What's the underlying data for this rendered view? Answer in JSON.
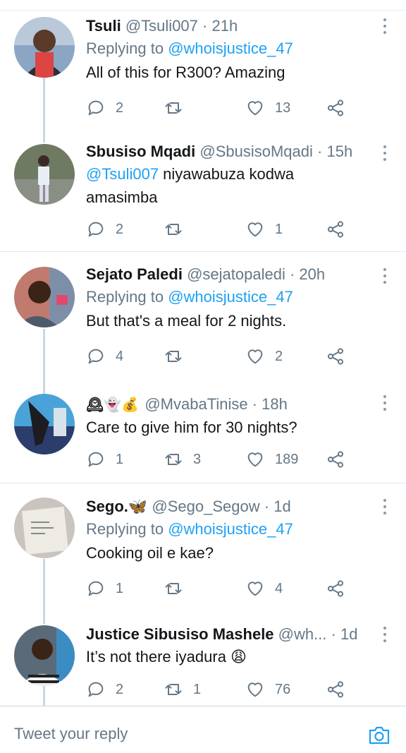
{
  "tweets": [
    {
      "name": "Tsuli",
      "handle": "@Tsuli007",
      "time": "21h",
      "replying_prefix": "Replying to",
      "replying_to": "@whoisjustice_47",
      "text": "All of this for R300? Amazing",
      "replies": "2",
      "retweets": "",
      "likes": "13"
    },
    {
      "name": "Sbusiso Mqadi",
      "handle": "@SbusisoMqadi",
      "time": "15h",
      "mention": "@Tsuli007",
      "text_line1": " niyawabuza kodwa",
      "text_line2": "amasimba",
      "replies": "2",
      "retweets": "",
      "likes": "1"
    },
    {
      "name": "Sejato Paledi",
      "handle": "@sejatopaledi",
      "time": "20h",
      "replying_prefix": "Replying to",
      "replying_to": "@whoisjustice_47",
      "text": "But that's a meal for 2 nights.",
      "replies": "4",
      "retweets": "",
      "likes": "2"
    },
    {
      "name": "🕰👻💰",
      "handle": "@MvabaTinise",
      "time": "18h",
      "text": "Care to give him for 30 nights?",
      "replies": "1",
      "retweets": "3",
      "likes": "189"
    },
    {
      "name": "Sego.🦋",
      "handle": "@Sego_Segow",
      "time": "1d",
      "replying_prefix": "Replying to",
      "replying_to": "@whoisjustice_47",
      "text": "Cooking oil e kae?",
      "replies": "1",
      "retweets": "",
      "likes": "4"
    },
    {
      "name": "Justice Sibusiso Mashele",
      "handle": "@wh...",
      "time": "1d",
      "text": "It’s not there iyadura 😩",
      "replies": "2",
      "retweets": "1",
      "likes": "76"
    }
  ],
  "separator": "·",
  "composer": {
    "placeholder": "Tweet your reply"
  },
  "colors": {
    "link": "#1da1f2",
    "muted": "#657786",
    "text": "#14171a"
  },
  "icons": [
    "reply-icon",
    "retweet-icon",
    "like-icon",
    "share-icon",
    "more-icon",
    "camera-icon"
  ]
}
